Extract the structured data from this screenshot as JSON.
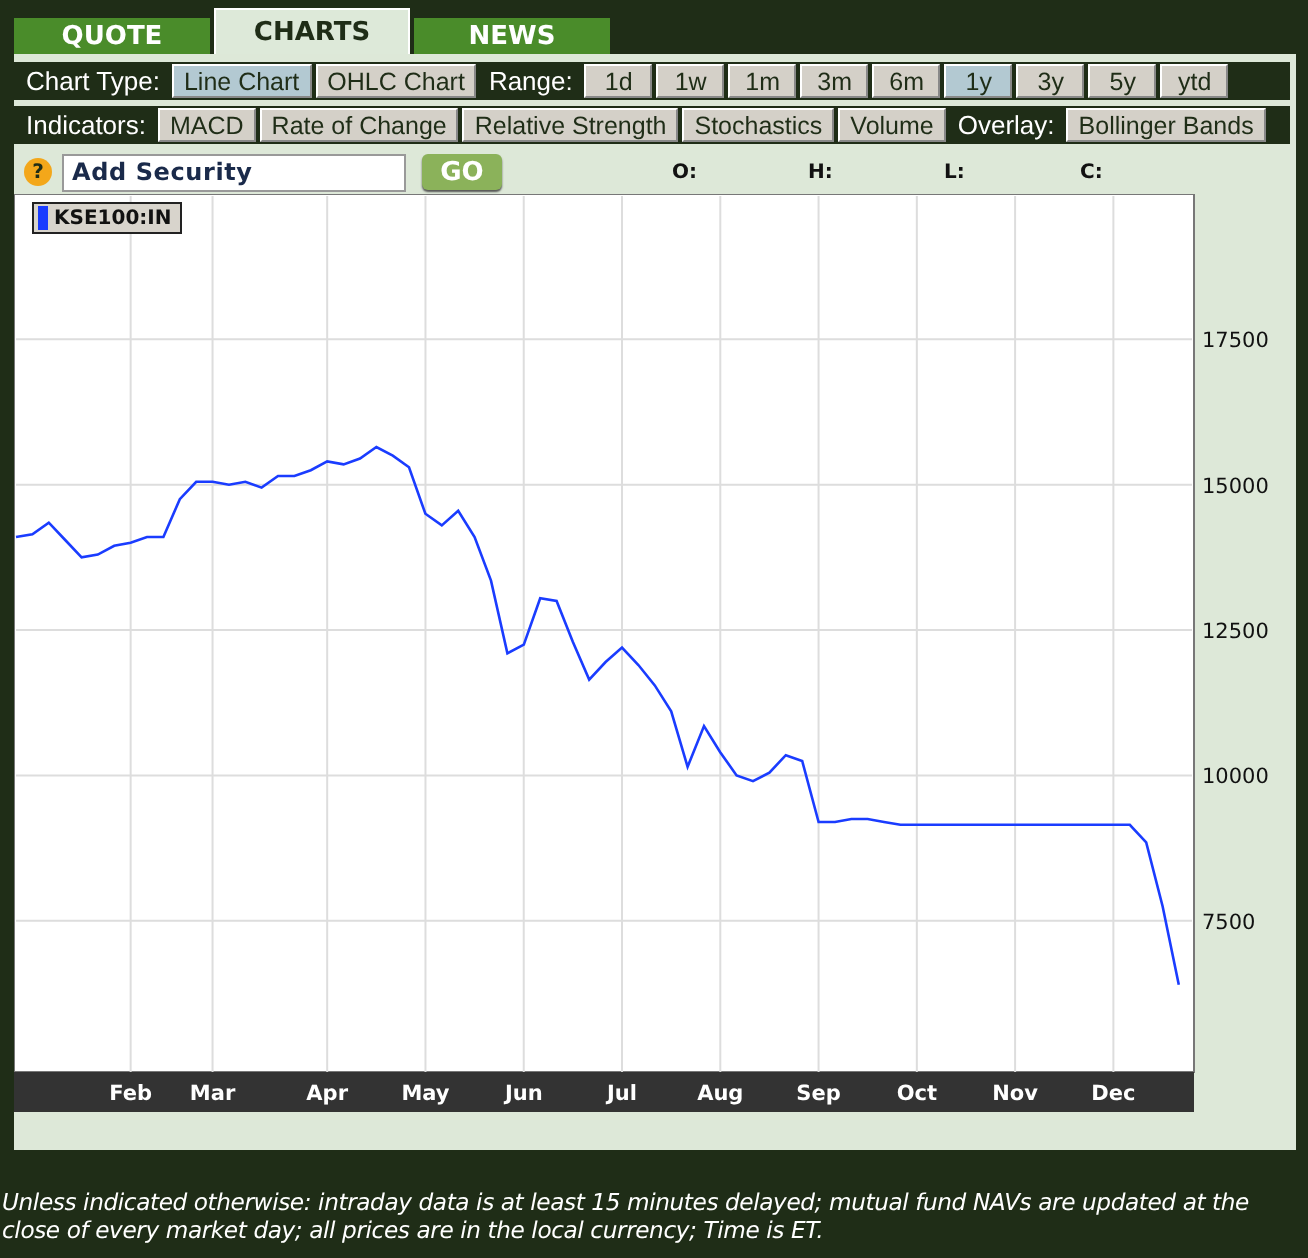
{
  "tabs": [
    {
      "label": "QUOTE",
      "selected": false
    },
    {
      "label": "CHARTS",
      "selected": true
    },
    {
      "label": "NEWS",
      "selected": false
    }
  ],
  "chart_type": {
    "label": "Chart Type:",
    "options": [
      {
        "label": "Line Chart",
        "selected": true
      },
      {
        "label": "OHLC Chart",
        "selected": false
      }
    ]
  },
  "range": {
    "label": "Range:",
    "options": [
      {
        "label": "1d",
        "selected": false
      },
      {
        "label": "1w",
        "selected": false
      },
      {
        "label": "1m",
        "selected": false
      },
      {
        "label": "3m",
        "selected": false
      },
      {
        "label": "6m",
        "selected": false
      },
      {
        "label": "1y",
        "selected": true
      },
      {
        "label": "3y",
        "selected": false
      },
      {
        "label": "5y",
        "selected": false
      },
      {
        "label": "ytd",
        "selected": false
      }
    ]
  },
  "indicators": {
    "label": "Indicators:",
    "options": [
      "MACD",
      "Rate of Change",
      "Relative Strength",
      "Stochastics",
      "Volume"
    ]
  },
  "overlay": {
    "label": "Overlay:",
    "options": [
      "Bollinger Bands"
    ]
  },
  "security": {
    "help": "?",
    "value": "Add Security",
    "button": "GO"
  },
  "quote_fields": [
    "O:",
    "H:",
    "L:",
    "C:"
  ],
  "chart": {
    "chart_data": {
      "type": "line",
      "categories": [
        null,
        null,
        null,
        null,
        null,
        null,
        null,
        "Feb",
        null,
        null,
        null,
        null,
        "Mar",
        null,
        null,
        null,
        null,
        null,
        null,
        "Apr",
        null,
        null,
        null,
        null,
        null,
        "May",
        null,
        null,
        null,
        null,
        null,
        "Jun",
        null,
        null,
        null,
        null,
        null,
        "Jul",
        null,
        null,
        null,
        null,
        null,
        "Aug",
        null,
        null,
        null,
        null,
        null,
        "Sep",
        null,
        null,
        null,
        null,
        null,
        "Oct",
        null,
        null,
        null,
        null,
        null,
        "Nov",
        null,
        null,
        null,
        null,
        null,
        "Dec",
        null,
        null,
        null,
        null
      ],
      "series": [
        {
          "name": "KSE100:IN",
          "color": "#1a3cff",
          "values": [
            14100,
            14150,
            14350,
            14050,
            13750,
            13800,
            13950,
            14000,
            14100,
            14100,
            14750,
            15050,
            15050,
            15000,
            15050,
            14950,
            15150,
            15150,
            15250,
            15400,
            15350,
            15450,
            15650,
            15500,
            15300,
            14500,
            14300,
            14550,
            14100,
            13350,
            12100,
            12250,
            13050,
            13000,
            12300,
            11650,
            11950,
            12200,
            11900,
            11550,
            11100,
            10150,
            10850,
            10400,
            10000,
            9900,
            10050,
            10350,
            10250,
            9200,
            9200,
            9250,
            9250,
            9200,
            9150,
            9150,
            9150,
            9150,
            9150,
            9150,
            9150,
            9150,
            9150,
            9150,
            9150,
            9150,
            9150,
            9150,
            9150,
            8850,
            7750,
            6400
          ]
        }
      ],
      "ylim": [
        4900,
        20000
      ],
      "grid": true,
      "yticks": [
        7500,
        10000,
        12500,
        15000,
        17500
      ]
    }
  },
  "footer": "Unless indicated otherwise: intraday data is at least 15 minutes delayed; mutual fund NAVs are updated at the close of every market day; all prices are in the local currency; Time is ET."
}
